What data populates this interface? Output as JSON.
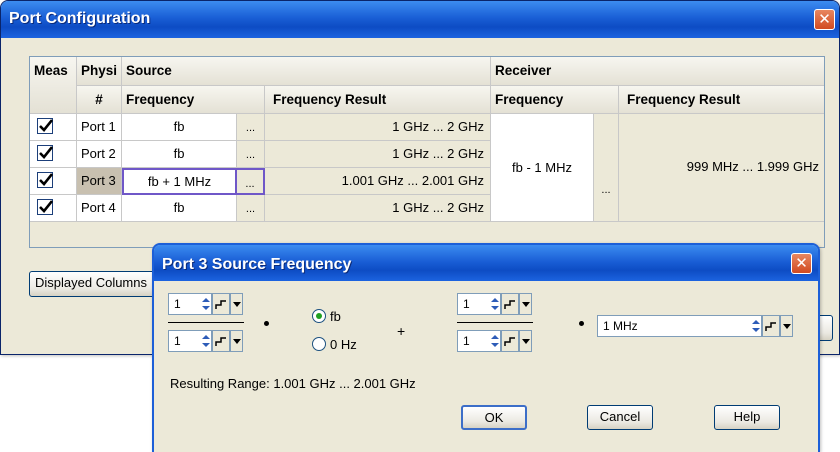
{
  "port_config": {
    "title": "Port Configuration",
    "close_icon": "close-icon",
    "headers": {
      "meas": "Meas",
      "physical": "Physi",
      "port_num": "#",
      "source": "Source",
      "receiver": "Receiver",
      "source_frequency": "Frequency",
      "source_frequency_result": "Frequency Result",
      "receiver_frequency": "Frequency",
      "receiver_frequency_result": "Frequency Result"
    },
    "rows": [
      {
        "port": "Port 1",
        "measured": true,
        "source_frequency": "fb",
        "ellipsis": "...",
        "source_result": "1 GHz ... 2 GHz"
      },
      {
        "port": "Port 2",
        "measured": true,
        "source_frequency": "fb",
        "ellipsis": "...",
        "source_result": "1 GHz ... 2 GHz"
      },
      {
        "port": "Port 3",
        "measured": true,
        "source_frequency": "fb + 1 MHz",
        "ellipsis": "...",
        "source_result": "1.001 GHz ... 2.001 GHz"
      },
      {
        "port": "Port 4",
        "measured": true,
        "source_frequency": "fb",
        "ellipsis": "...",
        "source_result": "1 GHz ... 2 GHz"
      }
    ],
    "receiver": {
      "frequency": "fb - 1 MHz",
      "ellipsis": "...",
      "result": "999 MHz ... 1.999 GHz"
    },
    "displayed_columns_label": "Displayed Columns"
  },
  "dialog": {
    "title": "Port 3 Source Frequency",
    "close_icon": "close-icon",
    "multiplier_numerator": "1",
    "multiplier_denominator": "1",
    "offset_numerator": "1",
    "offset_denominator": "1",
    "radio_fb": "fb",
    "radio_0hz": "0 Hz",
    "selected_radio": "fb",
    "plus": "+",
    "offset_value": "1 MHz",
    "resulting_range": "Resulting Range: 1.001 GHz ... 2.001 GHz",
    "ok": "OK",
    "cancel": "Cancel",
    "help": "Help"
  },
  "colors": {
    "titlebar": "#1a5fd6",
    "close_button": "#d14a20",
    "window_face": "#ece9d8",
    "grid_border": "#7f9db9",
    "edit_border": "#6f57c8",
    "radio_dot": "#20a020"
  }
}
